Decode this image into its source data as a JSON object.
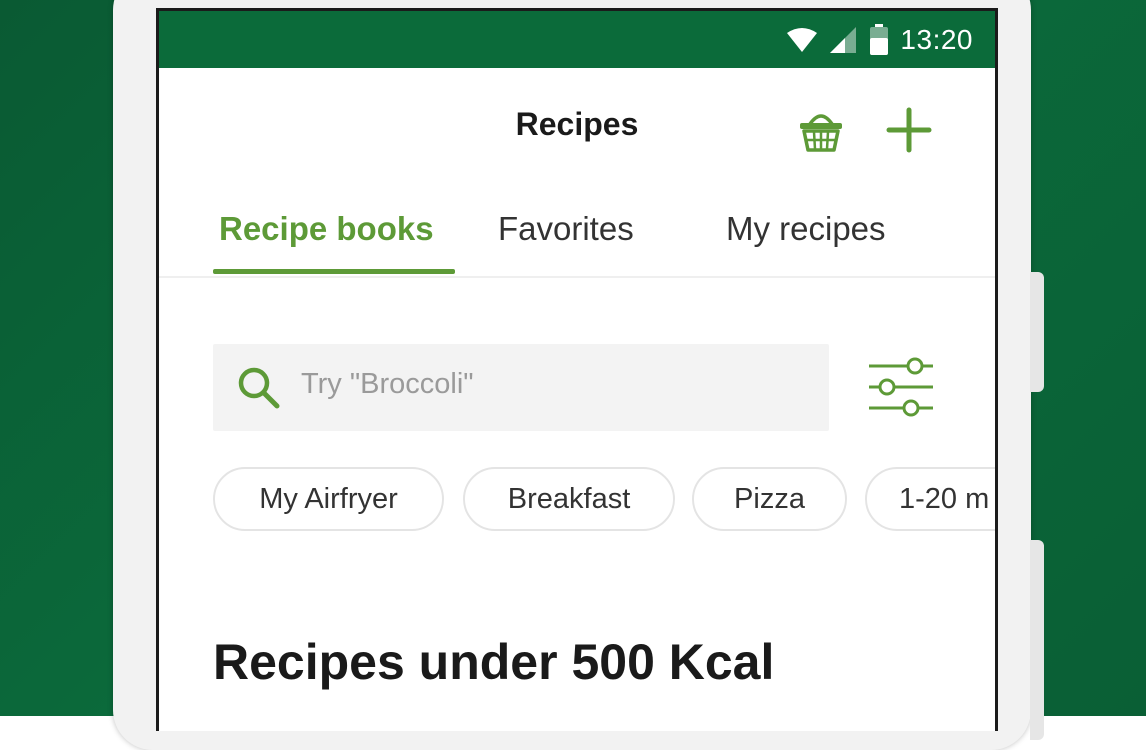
{
  "status_bar": {
    "time": "13:20",
    "icons": [
      "wifi-icon",
      "signal-icon",
      "battery-icon"
    ]
  },
  "app_bar": {
    "title": "Recipes",
    "actions": [
      "basket-icon",
      "add-icon"
    ]
  },
  "tabs": [
    {
      "label": "Recipe books",
      "active": true
    },
    {
      "label": "Favorites",
      "active": false
    },
    {
      "label": "My recipes",
      "active": false
    }
  ],
  "search": {
    "placeholder": "Try \"Broccoli\"",
    "icon": "search-icon",
    "filter_icon": "filter-sliders-icon"
  },
  "chips": [
    {
      "label": "My Airfryer"
    },
    {
      "label": "Breakfast"
    },
    {
      "label": "Pizza"
    },
    {
      "label": "1-20 m"
    }
  ],
  "section": {
    "title": "Recipes under 500 Kcal"
  },
  "colors": {
    "status_bar": "#0b6b3a",
    "accent_green": "#5d9a37",
    "background_green": "#0b6a3b"
  }
}
